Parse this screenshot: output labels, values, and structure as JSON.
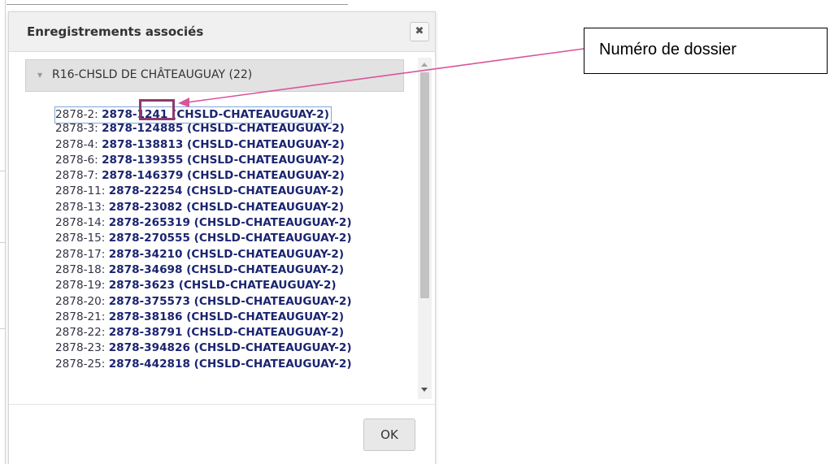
{
  "dialog": {
    "title": "Enregistrements associés",
    "close_icon": "close-icon",
    "ok_label": "OK"
  },
  "group": {
    "label": "R16-CHSLD DE CHÂTEAUGUAY (22)"
  },
  "records": [
    {
      "key": "2878-2: ",
      "value": "2878-1241 (CHSLD-CHATEAUGUAY-2)"
    },
    {
      "key": "2878-3: ",
      "value": "2878-124885 (CHSLD-CHATEAUGUAY-2)"
    },
    {
      "key": "2878-4: ",
      "value": "2878-138813 (CHSLD-CHATEAUGUAY-2)"
    },
    {
      "key": "2878-6: ",
      "value": "2878-139355 (CHSLD-CHATEAUGUAY-2)"
    },
    {
      "key": "2878-7: ",
      "value": "2878-146379 (CHSLD-CHATEAUGUAY-2)"
    },
    {
      "key": "2878-11: ",
      "value": "2878-22254 (CHSLD-CHATEAUGUAY-2)"
    },
    {
      "key": "2878-13: ",
      "value": "2878-23082 (CHSLD-CHATEAUGUAY-2)"
    },
    {
      "key": "2878-14: ",
      "value": "2878-265319 (CHSLD-CHATEAUGUAY-2)"
    },
    {
      "key": "2878-15: ",
      "value": "2878-270555 (CHSLD-CHATEAUGUAY-2)"
    },
    {
      "key": "2878-17: ",
      "value": "2878-34210 (CHSLD-CHATEAUGUAY-2)"
    },
    {
      "key": "2878-18: ",
      "value": "2878-34698 (CHSLD-CHATEAUGUAY-2)"
    },
    {
      "key": "2878-19: ",
      "value": "2878-3623 (CHSLD-CHATEAUGUAY-2)"
    },
    {
      "key": "2878-20: ",
      "value": "2878-375573 (CHSLD-CHATEAUGUAY-2)"
    },
    {
      "key": "2878-21: ",
      "value": "2878-38186 (CHSLD-CHATEAUGUAY-2)"
    },
    {
      "key": "2878-22: ",
      "value": "2878-38791 (CHSLD-CHATEAUGUAY-2)"
    },
    {
      "key": "2878-23: ",
      "value": "2878-394826 (CHSLD-CHATEAUGUAY-2)"
    },
    {
      "key": "2878-25: ",
      "value": "2878-442818 (CHSLD-CHATEAUGUAY-2)"
    }
  ],
  "annotation": {
    "callout_text": "Numéro de dossier",
    "arrow_color": "#d9559a",
    "highlight_color": "#8c3a6e"
  },
  "colors": {
    "record_value": "#1b2570",
    "selection_outline": "#7fa6d8"
  }
}
